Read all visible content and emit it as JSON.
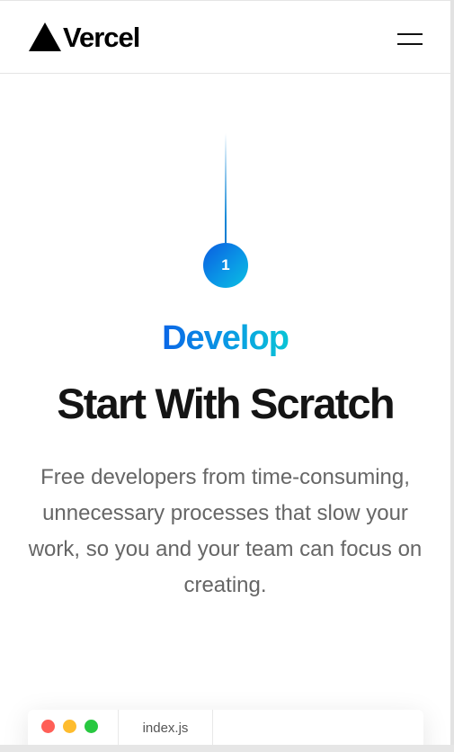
{
  "header": {
    "logo_text": "Vercel",
    "logo_icon": "triangle-logo-icon",
    "menu_icon": "hamburger-menu-icon"
  },
  "step": {
    "number": "1"
  },
  "section": {
    "eyebrow": "Develop",
    "title": "Start With Scratch",
    "description": "Free developers from time-consuming, unnecessary processes that slow your work, so you and your team can focus on creating."
  },
  "code_window": {
    "dot_colors": [
      "#ff5f57",
      "#febc2e",
      "#28c840"
    ],
    "tab_label": "index.js"
  },
  "colors": {
    "accent_start": "#0a66e6",
    "accent_end": "#0ac4d6",
    "title": "#141414",
    "body_text": "#666666"
  }
}
